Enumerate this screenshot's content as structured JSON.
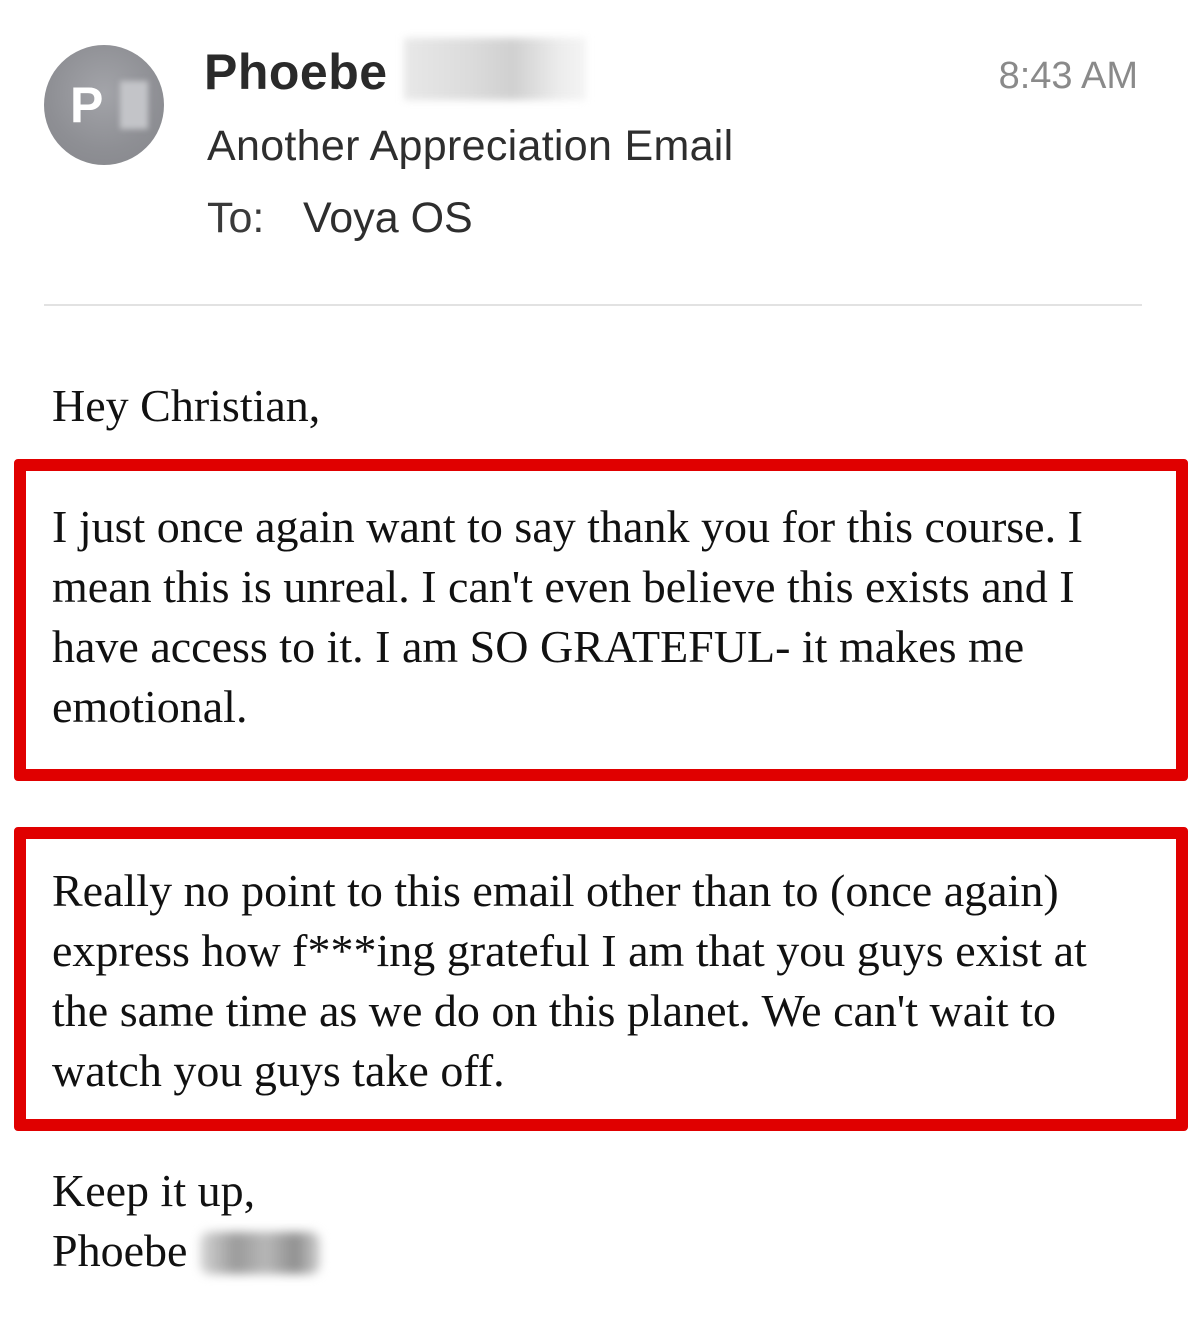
{
  "header": {
    "avatar_initial": "P",
    "sender_name": "Phoebe",
    "time": "8:43 AM",
    "subject": "Another Appreciation Email",
    "to_label": "To:",
    "to_value": "Voya OS"
  },
  "body": {
    "greeting": "Hey Christian,",
    "paragraph1_lines": [
      "I just once again want to say thank you for this course. I",
      "mean this is unreal. I can't even believe this exists and I",
      "have access to it. I am SO GRATEFUL- it makes me",
      "emotional."
    ],
    "paragraph2_lines": [
      "Really no point to this email other than to (once again)",
      "express how f***ing grateful I am that you guys exist at",
      "the same time as we do on this planet. We can't wait to",
      "watch you guys take off."
    ],
    "signoff": "Keep it up,",
    "signature": "Phoebe"
  },
  "colors": {
    "highlight_border": "#e00000",
    "avatar_bg": "#8e8f94",
    "timestamp": "#8a8a8a",
    "divider": "#e2e2e2"
  },
  "icons": {
    "avatar": "sender-avatar-circle"
  }
}
